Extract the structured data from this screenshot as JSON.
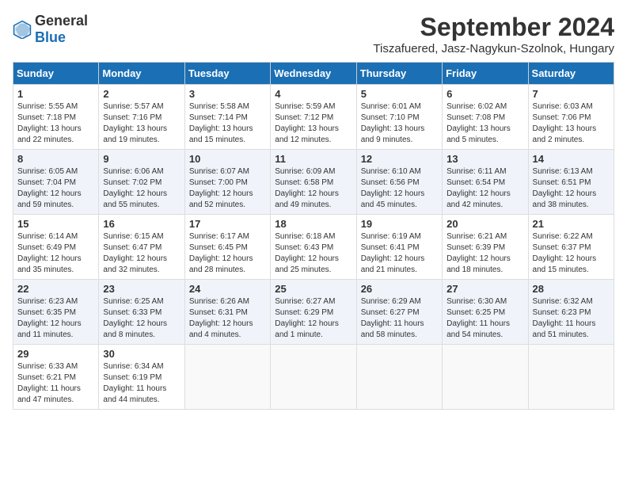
{
  "header": {
    "logo_general": "General",
    "logo_blue": "Blue",
    "main_title": "September 2024",
    "subtitle": "Tiszafuered, Jasz-Nagykun-Szolnok, Hungary"
  },
  "days_of_week": [
    "Sunday",
    "Monday",
    "Tuesday",
    "Wednesday",
    "Thursday",
    "Friday",
    "Saturday"
  ],
  "weeks": [
    [
      {
        "day": "1",
        "info": "Sunrise: 5:55 AM\nSunset: 7:18 PM\nDaylight: 13 hours\nand 22 minutes."
      },
      {
        "day": "2",
        "info": "Sunrise: 5:57 AM\nSunset: 7:16 PM\nDaylight: 13 hours\nand 19 minutes."
      },
      {
        "day": "3",
        "info": "Sunrise: 5:58 AM\nSunset: 7:14 PM\nDaylight: 13 hours\nand 15 minutes."
      },
      {
        "day": "4",
        "info": "Sunrise: 5:59 AM\nSunset: 7:12 PM\nDaylight: 13 hours\nand 12 minutes."
      },
      {
        "day": "5",
        "info": "Sunrise: 6:01 AM\nSunset: 7:10 PM\nDaylight: 13 hours\nand 9 minutes."
      },
      {
        "day": "6",
        "info": "Sunrise: 6:02 AM\nSunset: 7:08 PM\nDaylight: 13 hours\nand 5 minutes."
      },
      {
        "day": "7",
        "info": "Sunrise: 6:03 AM\nSunset: 7:06 PM\nDaylight: 13 hours\nand 2 minutes."
      }
    ],
    [
      {
        "day": "8",
        "info": "Sunrise: 6:05 AM\nSunset: 7:04 PM\nDaylight: 12 hours\nand 59 minutes."
      },
      {
        "day": "9",
        "info": "Sunrise: 6:06 AM\nSunset: 7:02 PM\nDaylight: 12 hours\nand 55 minutes."
      },
      {
        "day": "10",
        "info": "Sunrise: 6:07 AM\nSunset: 7:00 PM\nDaylight: 12 hours\nand 52 minutes."
      },
      {
        "day": "11",
        "info": "Sunrise: 6:09 AM\nSunset: 6:58 PM\nDaylight: 12 hours\nand 49 minutes."
      },
      {
        "day": "12",
        "info": "Sunrise: 6:10 AM\nSunset: 6:56 PM\nDaylight: 12 hours\nand 45 minutes."
      },
      {
        "day": "13",
        "info": "Sunrise: 6:11 AM\nSunset: 6:54 PM\nDaylight: 12 hours\nand 42 minutes."
      },
      {
        "day": "14",
        "info": "Sunrise: 6:13 AM\nSunset: 6:51 PM\nDaylight: 12 hours\nand 38 minutes."
      }
    ],
    [
      {
        "day": "15",
        "info": "Sunrise: 6:14 AM\nSunset: 6:49 PM\nDaylight: 12 hours\nand 35 minutes."
      },
      {
        "day": "16",
        "info": "Sunrise: 6:15 AM\nSunset: 6:47 PM\nDaylight: 12 hours\nand 32 minutes."
      },
      {
        "day": "17",
        "info": "Sunrise: 6:17 AM\nSunset: 6:45 PM\nDaylight: 12 hours\nand 28 minutes."
      },
      {
        "day": "18",
        "info": "Sunrise: 6:18 AM\nSunset: 6:43 PM\nDaylight: 12 hours\nand 25 minutes."
      },
      {
        "day": "19",
        "info": "Sunrise: 6:19 AM\nSunset: 6:41 PM\nDaylight: 12 hours\nand 21 minutes."
      },
      {
        "day": "20",
        "info": "Sunrise: 6:21 AM\nSunset: 6:39 PM\nDaylight: 12 hours\nand 18 minutes."
      },
      {
        "day": "21",
        "info": "Sunrise: 6:22 AM\nSunset: 6:37 PM\nDaylight: 12 hours\nand 15 minutes."
      }
    ],
    [
      {
        "day": "22",
        "info": "Sunrise: 6:23 AM\nSunset: 6:35 PM\nDaylight: 12 hours\nand 11 minutes."
      },
      {
        "day": "23",
        "info": "Sunrise: 6:25 AM\nSunset: 6:33 PM\nDaylight: 12 hours\nand 8 minutes."
      },
      {
        "day": "24",
        "info": "Sunrise: 6:26 AM\nSunset: 6:31 PM\nDaylight: 12 hours\nand 4 minutes."
      },
      {
        "day": "25",
        "info": "Sunrise: 6:27 AM\nSunset: 6:29 PM\nDaylight: 12 hours\nand 1 minute."
      },
      {
        "day": "26",
        "info": "Sunrise: 6:29 AM\nSunset: 6:27 PM\nDaylight: 11 hours\nand 58 minutes."
      },
      {
        "day": "27",
        "info": "Sunrise: 6:30 AM\nSunset: 6:25 PM\nDaylight: 11 hours\nand 54 minutes."
      },
      {
        "day": "28",
        "info": "Sunrise: 6:32 AM\nSunset: 6:23 PM\nDaylight: 11 hours\nand 51 minutes."
      }
    ],
    [
      {
        "day": "29",
        "info": "Sunrise: 6:33 AM\nSunset: 6:21 PM\nDaylight: 11 hours\nand 47 minutes."
      },
      {
        "day": "30",
        "info": "Sunrise: 6:34 AM\nSunset: 6:19 PM\nDaylight: 11 hours\nand 44 minutes."
      },
      {
        "day": "",
        "info": ""
      },
      {
        "day": "",
        "info": ""
      },
      {
        "day": "",
        "info": ""
      },
      {
        "day": "",
        "info": ""
      },
      {
        "day": "",
        "info": ""
      }
    ]
  ]
}
